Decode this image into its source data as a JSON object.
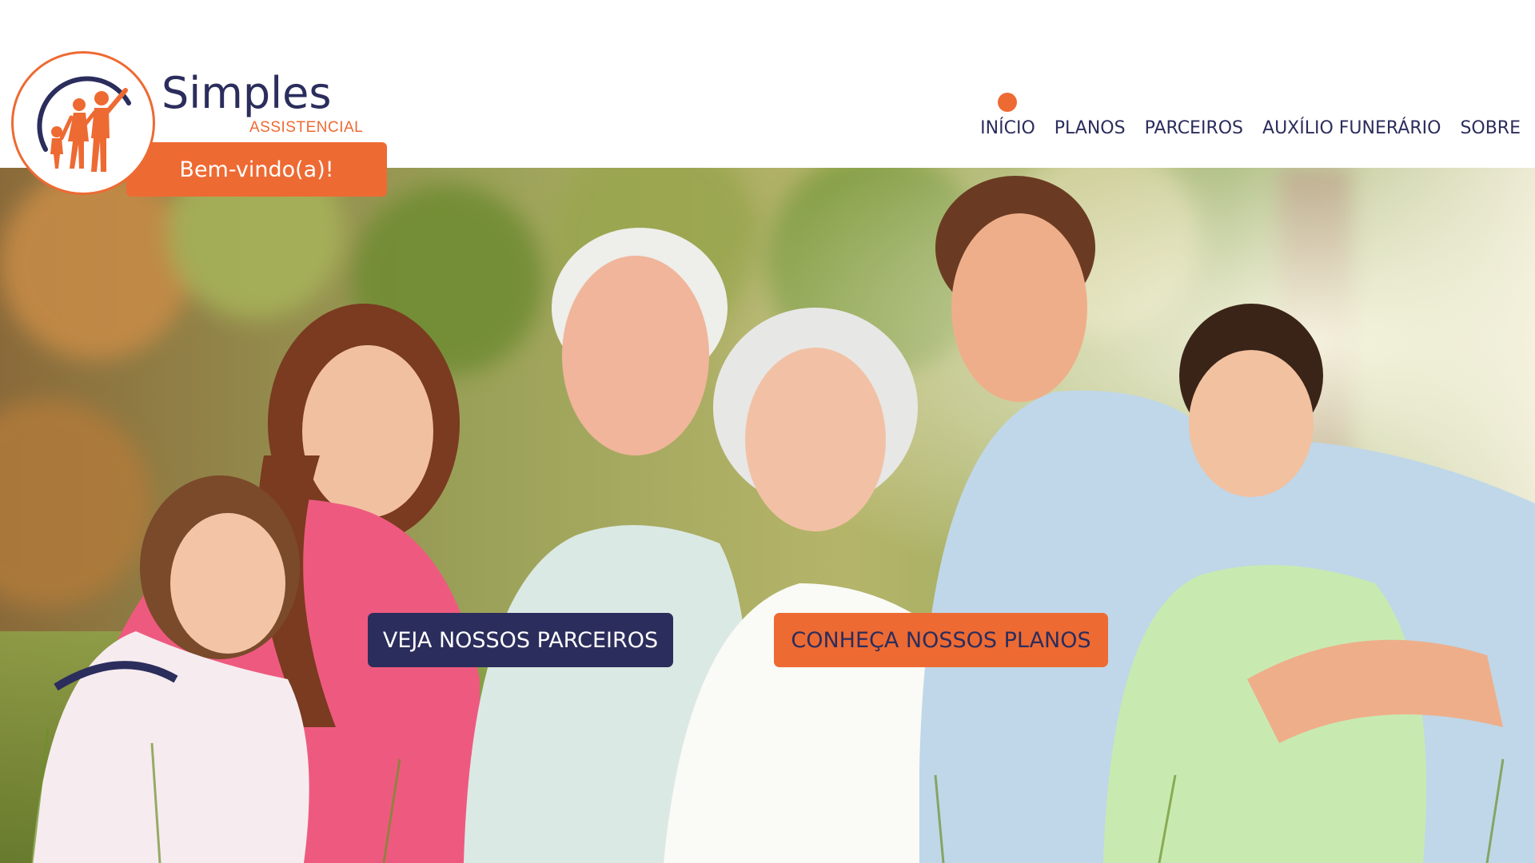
{
  "brand": {
    "name": "Simples",
    "subtitle": "ASSISTENCIAL",
    "welcome": "Bem-vindo(a)!",
    "logo_icon": "family-icon"
  },
  "nav": {
    "items": [
      {
        "label": "INÍCIO",
        "active": true
      },
      {
        "label": "PLANOS",
        "active": false
      },
      {
        "label": "PARCEIROS",
        "active": false
      },
      {
        "label": "AUXÍLIO FUNERÁRIO",
        "active": false
      },
      {
        "label": "SOBRE",
        "active": false
      }
    ]
  },
  "hero": {
    "image": "family-photo",
    "buttons": {
      "partners": "VEJA NOSSOS PARCEIROS",
      "plans": "CONHEÇA NOSSOS PLANOS"
    }
  },
  "colors": {
    "orange": "#ee6a33",
    "navy": "#2b2d5c",
    "white": "#ffffff"
  }
}
